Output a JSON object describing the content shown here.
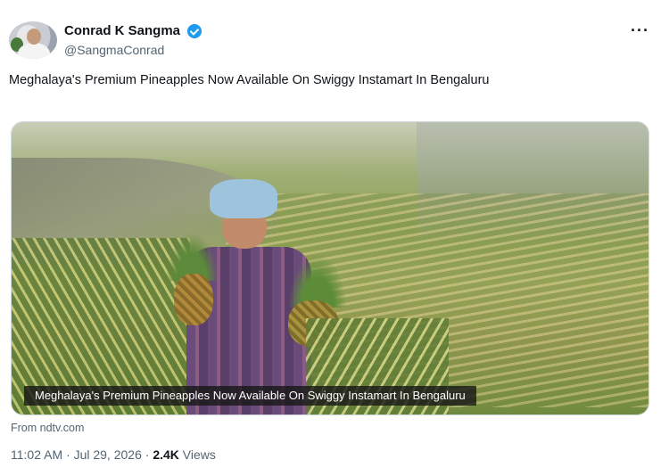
{
  "author": {
    "display_name": "Conrad K Sangma",
    "handle": "@SangmaConrad",
    "avatar_icon": "profile-photo",
    "verified_icon": "verified-badge-icon",
    "verified_color": "#1d9bf0"
  },
  "more_icon": "···",
  "tweet": {
    "text": "Meghalaya's Premium Pineapples Now Available On Swiggy Instamart In Bengaluru"
  },
  "media": {
    "caption": "Meghalaya's Premium Pineapples Now Available On Swiggy Instamart In Bengaluru"
  },
  "source": {
    "text": "From ndtv.com"
  },
  "meta": {
    "time": "11:02 AM",
    "separator_1": "·",
    "date": "Jul 29, 2026",
    "separator_2": "·",
    "views_count": "2.4K",
    "views_label": "Views"
  }
}
